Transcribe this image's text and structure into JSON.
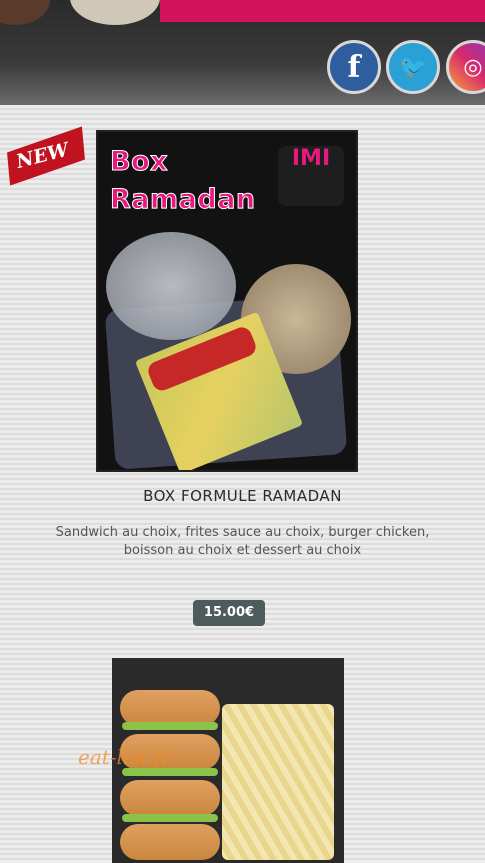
{
  "social": {
    "facebook": {
      "glyph": "f",
      "icon": "facebook-icon",
      "color": "#2f5e9e"
    },
    "twitter": {
      "glyph": "🐦",
      "icon": "twitter-icon",
      "color": "#2aa0d6"
    },
    "instagram": {
      "glyph": "◎",
      "icon": "instagram-icon",
      "color": "#d6296b"
    }
  },
  "product1": {
    "badge": "NEW",
    "image_title_line1": "Box",
    "image_title_line2": "Ramadan",
    "image_logo": "IMI",
    "name": "BOX FORMULE RAMADAN",
    "description": "Sandwich au choix, frites sauce au choix, burger chicken, boisson au choix et dessert au choix",
    "price": "15.00€"
  },
  "product2": {
    "watermark": "eat-list.fr"
  }
}
